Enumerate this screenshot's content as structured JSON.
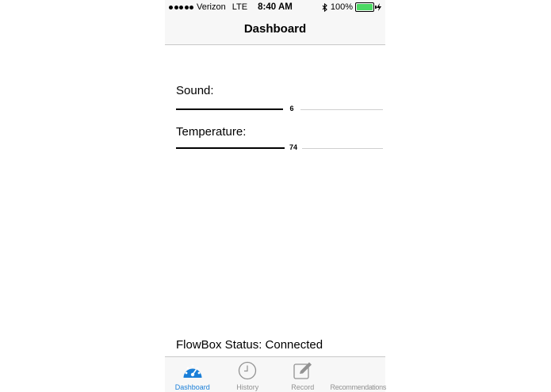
{
  "status_bar": {
    "carrier": "Verizon",
    "network": "LTE",
    "time": "8:40 AM",
    "battery": "100%",
    "battery_level": 1.0,
    "battery_color": "#4cd964"
  },
  "nav": {
    "title": "Dashboard"
  },
  "metrics": [
    {
      "label": "Sound:",
      "value": "6",
      "fraction": 0.6
    },
    {
      "label": "Temperature:",
      "value": "74",
      "fraction": 0.61
    }
  ],
  "connection_status": "FlowBox Status: Connected",
  "tabs": [
    {
      "label": "Dashboard",
      "icon": "speedometer-icon",
      "active": true
    },
    {
      "label": "History",
      "icon": "clock-icon",
      "active": false
    },
    {
      "label": "Record",
      "icon": "edit-icon",
      "active": false
    },
    {
      "label": "Recommendations",
      "icon": "list-icon",
      "active": false
    }
  ],
  "colors": {
    "accent": "#1a7fd8",
    "inactive": "#929292"
  }
}
